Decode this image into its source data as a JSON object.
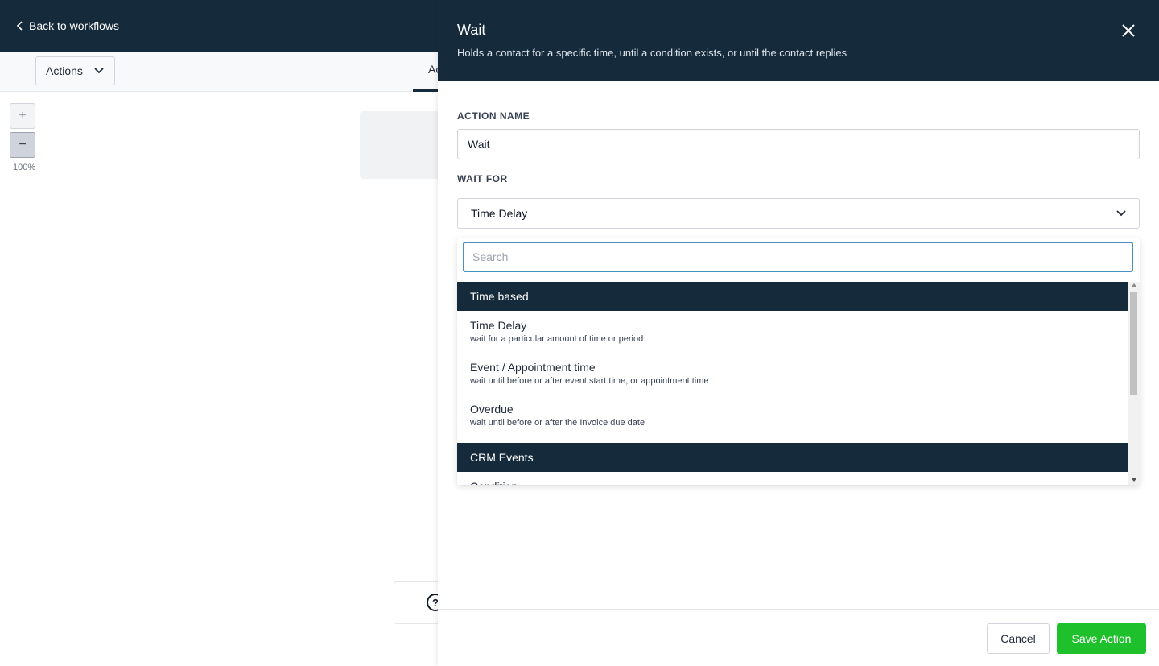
{
  "header": {
    "back_label": "Back to workflows"
  },
  "toolbar": {
    "actions_label": "Actions",
    "tab_partial_label": "Ac"
  },
  "zoom": {
    "in_label": "+",
    "out_label": "−",
    "level": "100%"
  },
  "help": {
    "icon_glyph": "?"
  },
  "drawer": {
    "title": "Wait",
    "subtitle": "Holds a contact for a specific time, until a condition exists, or until the contact replies",
    "action_name_label": "ACTION NAME",
    "action_name_value": "Wait",
    "wait_for_label": "WAIT FOR",
    "wait_for_selected": "Time Delay",
    "search_placeholder": "Search",
    "groups": [
      {
        "label": "Time based",
        "options": [
          {
            "title": "Time Delay",
            "description": "wait for a particular amount of time or period"
          },
          {
            "title": "Event / Appointment time",
            "description": "wait until before or after event start time, or appointment time"
          },
          {
            "title": "Overdue",
            "description": "wait until before or after the Invoice due date"
          }
        ]
      },
      {
        "label": "CRM Events",
        "partial_option": "Condition"
      }
    ],
    "cancel_label": "Cancel",
    "save_label": "Save Action"
  },
  "colors": {
    "header_bg": "#152b3c",
    "primary_green": "#1ec12c",
    "focus_blue": "#4a90c2"
  }
}
